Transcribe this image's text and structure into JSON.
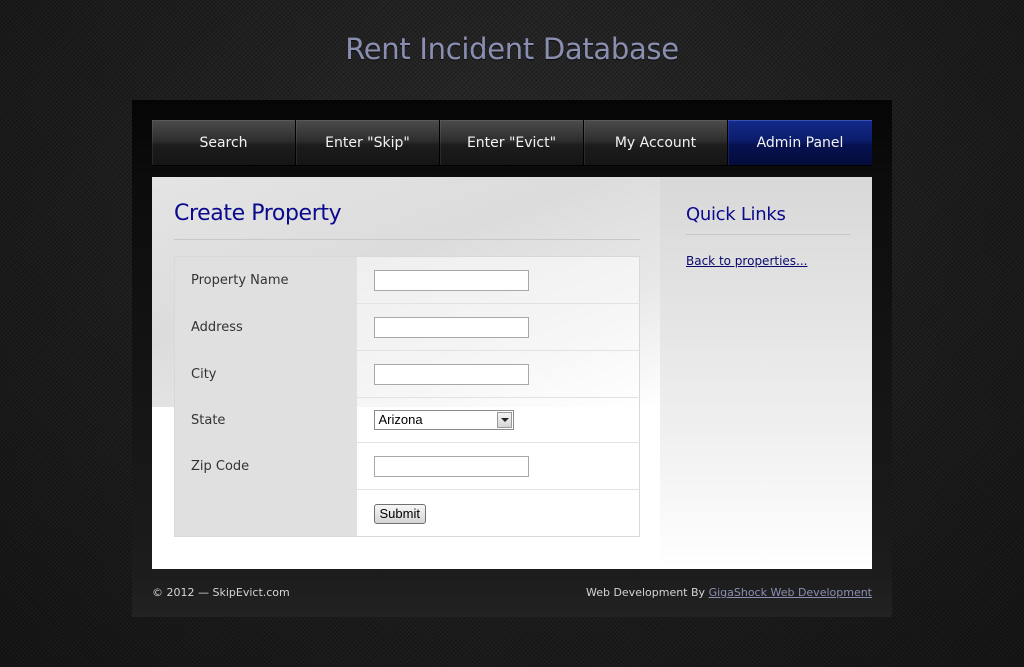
{
  "site": {
    "title": "Rent Incident Database"
  },
  "nav": {
    "items": [
      {
        "label": "Search"
      },
      {
        "label": "Enter \"Skip\""
      },
      {
        "label": "Enter \"Evict\""
      },
      {
        "label": "My Account"
      },
      {
        "label": "Admin Panel",
        "active": true
      }
    ]
  },
  "main": {
    "title": "Create Property",
    "form": {
      "property_name": {
        "label": "Property Name",
        "value": ""
      },
      "address": {
        "label": "Address",
        "value": ""
      },
      "city": {
        "label": "City",
        "value": ""
      },
      "state": {
        "label": "State",
        "selected": "Arizona"
      },
      "zip_code": {
        "label": "Zip Code",
        "value": ""
      },
      "submit_label": "Submit"
    }
  },
  "sidebar": {
    "title": "Quick Links",
    "link_label": "Back to properties..."
  },
  "footer": {
    "copyright": "© 2012 — SkipEvict.com",
    "credit_prefix": "Web Development By ",
    "credit_link": "GigaShock Web Development"
  },
  "colors": {
    "accent": "#0a0a8c",
    "nav_active": "#0b1c6a",
    "title": "#8a8fb2"
  }
}
